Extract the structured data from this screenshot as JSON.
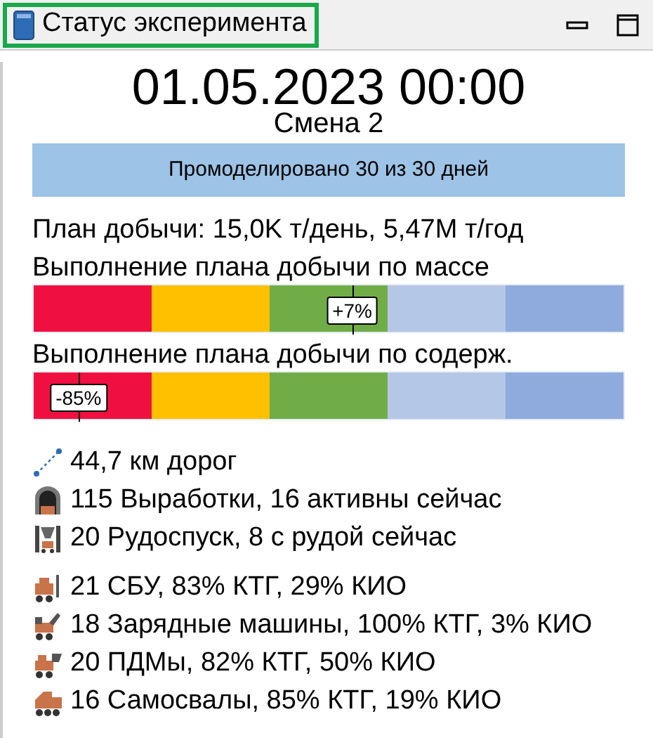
{
  "window": {
    "tab": {
      "title": "Статус эксперимента",
      "selected": true
    },
    "buttons": [
      {
        "kind": "minimize"
      },
      {
        "kind": "maximize"
      }
    ]
  },
  "datetime": "01.05.2023 00:00",
  "shift": "Смена 2",
  "simulation": {
    "text": "Промоделировано 30 из 30 дней",
    "level": 1
  },
  "plan": "План добычи: 15,0K т/день, 5,47M т/год",
  "scale": [
    {
      "color": "#f01040"
    },
    {
      "color": "#ffc000"
    },
    {
      "color": "#70ad47"
    },
    {
      "color": "#b4c7e7"
    },
    {
      "color": "#8faadc"
    }
  ],
  "gauges": [
    {
      "label": "Выполнение плана добычи по массе",
      "marker": "+7%",
      "level": 0.54
    },
    {
      "label": "Выполнение плана добычи по содерж.",
      "marker": "-85%",
      "level": 0.076
    }
  ],
  "infrastructure": [
    {
      "kind": "road",
      "text": "44,7 км дорог"
    },
    {
      "kind": "tunnel",
      "text": "115 Выработки, 16 активны сейчас"
    },
    {
      "kind": "orepass",
      "text": "20 Рудоспуск, 8 с рудой сейчас"
    }
  ],
  "equipment": [
    {
      "kind": "drill",
      "text": "21 СБУ, 83% КТГ, 29% КИО"
    },
    {
      "kind": "charger",
      "text": "18 Зарядные машины, 100% КТГ, 3% КИО"
    },
    {
      "kind": "loader",
      "text": "20 ПДМы, 82% КТГ, 50% КИО"
    },
    {
      "kind": "truck",
      "text": "16 Самосвалы, 85% КТГ, 19% КИО"
    }
  ]
}
